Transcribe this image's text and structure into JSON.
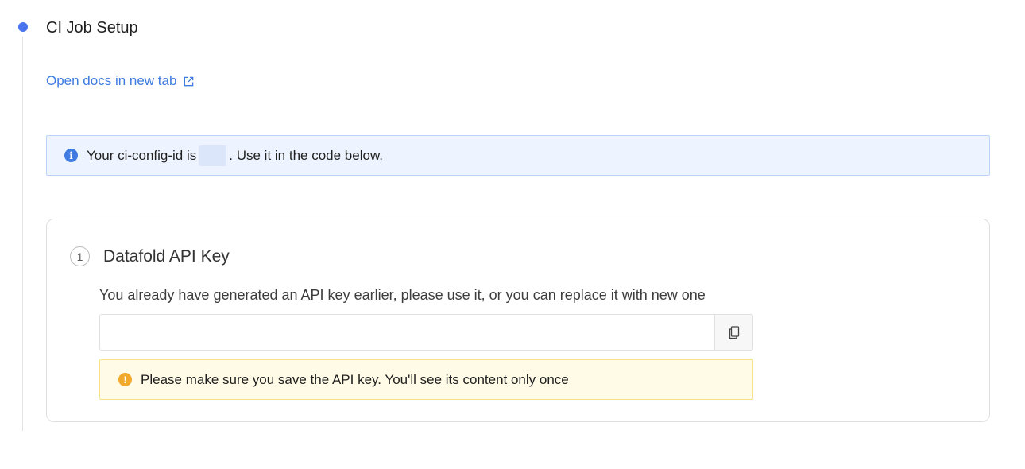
{
  "step": {
    "title": "CI Job Setup",
    "docs_link": "Open docs in new tab"
  },
  "info_banner": {
    "text_before": "Your ci-config-id is",
    "config_id": "",
    "text_after": ". Use it in the code below.",
    "icon": "info-icon"
  },
  "api_key_card": {
    "number": "1",
    "title": "Datafold API Key",
    "description": "You already have generated an API key earlier, please use it, or you can replace it with new one",
    "key_value": "",
    "copy_icon": "copy-icon",
    "warning": "Please make sure you save the API key. You'll see its content only once",
    "warning_icon": "exclamation-icon"
  },
  "colors": {
    "accent": "#4a74ee",
    "link": "#3f7be0",
    "info_bg": "#eef4ff",
    "warning_bg": "#fffbe7",
    "warning_icon": "#f0a92c"
  }
}
